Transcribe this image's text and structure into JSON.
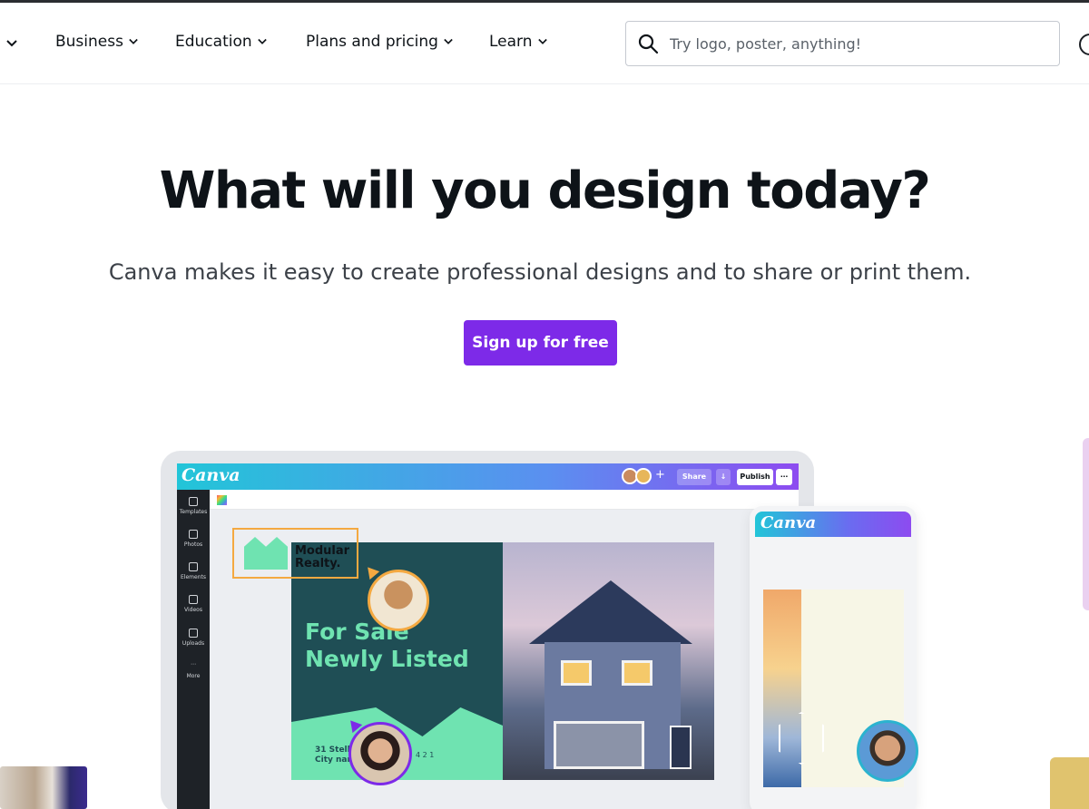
{
  "nav": {
    "items": [
      {
        "label": "Business"
      },
      {
        "label": "Education"
      },
      {
        "label": "Plans and pricing"
      },
      {
        "label": "Learn"
      }
    ],
    "search_placeholder": "Try logo, poster, anything!"
  },
  "hero": {
    "title": "What will you design today?",
    "subtitle": "Canva makes it easy to create professional designs and to share or print them.",
    "cta_label": "Sign up for free"
  },
  "illustration": {
    "editor_logo": "Canva",
    "share_label": "Share",
    "publish_label": "Publish",
    "sidebar": [
      "Templates",
      "Photos",
      "Elements",
      "Videos",
      "Uploads",
      "More"
    ],
    "brand_name_line1": "Modular",
    "brand_name_line2": "Realty.",
    "headline_line1": "For Sale",
    "headline_line2": "Newly Listed",
    "address_line1": "31 Stella",
    "address_line2": "City nam",
    "meta": "4   2   1",
    "phone_logo": "Canva"
  },
  "colors": {
    "accent": "#7d2ae8",
    "mint": "#6fe3b1",
    "teal_dark": "#1f4e55"
  }
}
